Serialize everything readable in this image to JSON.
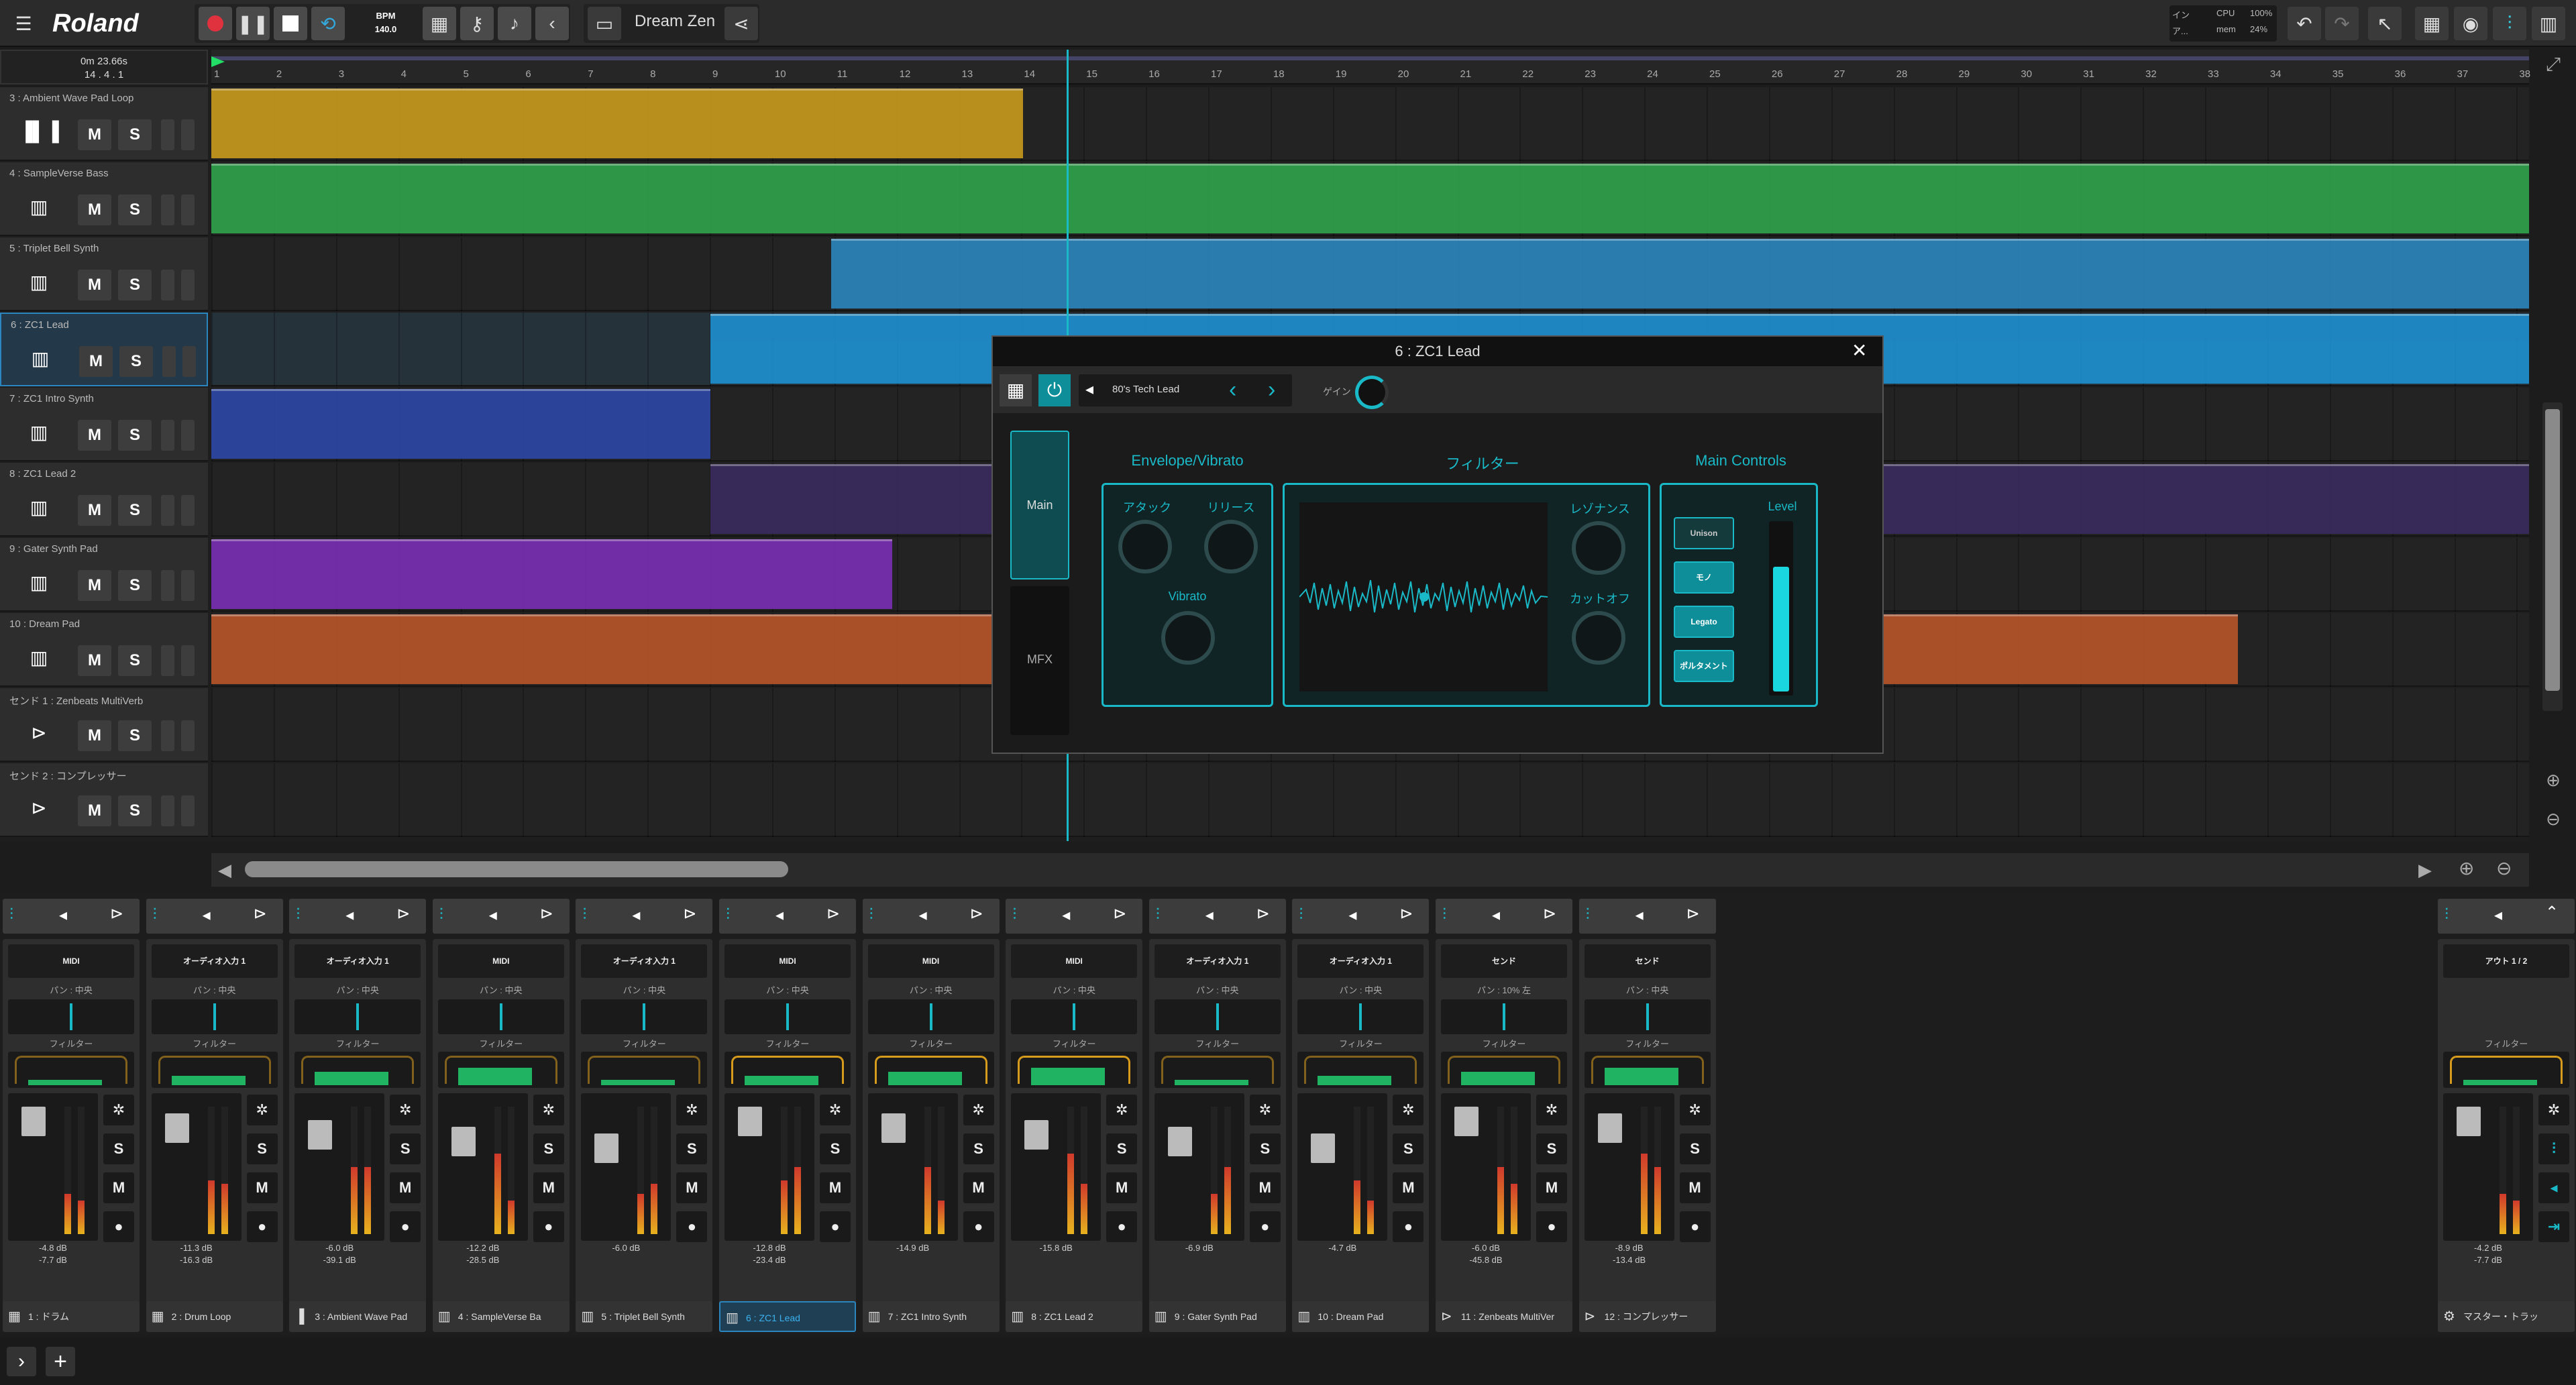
{
  "topbar": {
    "logo": "Roland",
    "bpm_label": "BPM",
    "bpm_value": "140.0",
    "project_name": "Dream Zen",
    "cpu_label": "CPU",
    "cpu_value": "100%",
    "mem_label": "mem",
    "mem_value": "24%",
    "in_label": "イン",
    "out_label": "ア..."
  },
  "timeline": {
    "time": "0m 23.66s",
    "position": "14 . 4 . 1",
    "bars": [
      "1",
      "2",
      "3",
      "4",
      "5",
      "6",
      "7",
      "8",
      "9",
      "10",
      "11",
      "12",
      "13",
      "14",
      "15",
      "16",
      "17",
      "18",
      "19",
      "20",
      "21",
      "22",
      "23",
      "24",
      "25",
      "26",
      "27",
      "28",
      "29",
      "30",
      "31",
      "32",
      "33",
      "34",
      "35",
      "36",
      "37",
      "38"
    ]
  },
  "tracks": [
    {
      "name": "3 : Ambient Wave Pad Loop",
      "icon": "waveform-icon",
      "m": "M",
      "s": "S",
      "color": "#c99a1c"
    },
    {
      "name": "4 : SampleVerse Bass",
      "icon": "keyboard-icon",
      "m": "M",
      "s": "S",
      "color": "#2fa34b"
    },
    {
      "name": "5 : Triplet Bell Synth",
      "icon": "keyboard-icon",
      "m": "M",
      "s": "S",
      "color": "#2b86bf"
    },
    {
      "name": "6 : ZC1 Lead",
      "icon": "keyboard-icon",
      "m": "M",
      "s": "S",
      "color": "#1e8fd0"
    },
    {
      "name": "7 : ZC1 Intro Synth",
      "icon": "keyboard-icon",
      "m": "M",
      "s": "S",
      "color": "#2c47a6"
    },
    {
      "name": "8 : ZC1 Lead 2",
      "icon": "keyboard-icon",
      "m": "M",
      "s": "S",
      "color": "#3a2a5e"
    },
    {
      "name": "9 : Gater Synth Pad",
      "icon": "keyboard-icon",
      "m": "M",
      "s": "S",
      "color": "#7a2fb5"
    },
    {
      "name": "10 : Dream Pad",
      "icon": "keyboard-icon",
      "m": "M",
      "s": "S",
      "color": "#b9552a"
    },
    {
      "name": "センド 1 : Zenbeats MultiVerb",
      "icon": "send-icon",
      "m": "M",
      "s": "S",
      "color": "#444"
    },
    {
      "name": "センド 2 : コンプレッサー",
      "icon": "send-icon",
      "m": "M",
      "s": "S",
      "color": "#444"
    }
  ],
  "plugin": {
    "title": "6 : ZC1 Lead",
    "preset": "80's Tech Lead",
    "gain_label": "ゲイン",
    "tab_main": "Main",
    "tab_mfx": "MFX",
    "env_title": "Envelope/Vibrato",
    "attack": "アタック",
    "release": "リリース",
    "vibrato": "Vibrato",
    "filter_title": "フィルター",
    "resonance": "レゾナンス",
    "cutoff": "カットオフ",
    "main_title": "Main Controls",
    "level": "Level",
    "btn_unison": "Unison",
    "btn_mono": "モノ",
    "btn_legato": "Legato",
    "btn_porta": "ポルタメント",
    "level_value": 0.75
  },
  "mixer": {
    "strips": [
      {
        "input": "MIDI",
        "pan": "パン : 中央",
        "filter": "フィルター",
        "db1": "-4.8 dB",
        "db2": "-7.7 dB",
        "name": "1 : ドラム",
        "icon": "drum-icon"
      },
      {
        "input": "オーディオ入力 1",
        "pan": "パン : 中央",
        "filter": "フィルター",
        "db1": "-11.3 dB",
        "db2": "-16.3 dB",
        "name": "2 : Drum Loop",
        "icon": "drum-icon"
      },
      {
        "input": "オーディオ入力 1",
        "pan": "パン : 中央",
        "filter": "フィルター",
        "db1": "-6.0 dB",
        "db2": "-39.1 dB",
        "name": "3 : Ambient Wave Pad",
        "icon": "waveform-icon"
      },
      {
        "input": "MIDI",
        "pan": "パン : 中央",
        "filter": "フィルター",
        "db1": "-12.2 dB",
        "db2": "-28.5 dB",
        "name": "4 : SampleVerse Ba",
        "icon": "keyboard-icon"
      },
      {
        "input": "オーディオ入力 1",
        "pan": "パン : 中央",
        "filter": "フィルター",
        "db1": "-6.0 dB",
        "db2": "",
        "name": "5 : Triplet Bell Synth",
        "icon": "keyboard-icon"
      },
      {
        "input": "MIDI",
        "pan": "パン : 中央",
        "filter": "フィルター",
        "db1": "-12.8 dB",
        "db2": "-23.4 dB",
        "name": "6 : ZC1 Lead",
        "icon": "keyboard-icon"
      },
      {
        "input": "MIDI",
        "pan": "パン : 中央",
        "filter": "フィルター",
        "db1": "-14.9 dB",
        "db2": "",
        "name": "7 : ZC1 Intro Synth",
        "icon": "keyboard-icon"
      },
      {
        "input": "MIDI",
        "pan": "パン : 中央",
        "filter": "フィルター",
        "db1": "-15.8 dB",
        "db2": "",
        "name": "8 : ZC1 Lead 2",
        "icon": "keyboard-icon"
      },
      {
        "input": "オーディオ入力 1",
        "pan": "パン : 中央",
        "filter": "フィルター",
        "db1": "-6.9 dB",
        "db2": "",
        "name": "9 : Gater Synth Pad",
        "icon": "keyboard-icon"
      },
      {
        "input": "オーディオ入力 1",
        "pan": "パン : 中央",
        "filter": "フィルター",
        "db1": "-4.7 dB",
        "db2": "",
        "name": "10 : Dream Pad",
        "icon": "keyboard-icon"
      },
      {
        "input": "センド",
        "pan": "パン : 10% 左",
        "filter": "フィルター",
        "db1": "-6.0 dB",
        "db2": "-45.8 dB",
        "name": "11 : Zenbeats MultiVer",
        "icon": "send-icon"
      },
      {
        "input": "センド",
        "pan": "パン : 中央",
        "filter": "フィルター",
        "db1": "-8.9 dB",
        "db2": "-13.4 dB",
        "name": "12 : コンプレッサー",
        "icon": "send-icon"
      }
    ],
    "master": {
      "input": "アウト 1 / 2",
      "filter": "フィルター",
      "db1": "-4.2 dB",
      "db2": "-7.7 dB",
      "name": "マスター・トラッ",
      "icon": "master-icon"
    }
  }
}
